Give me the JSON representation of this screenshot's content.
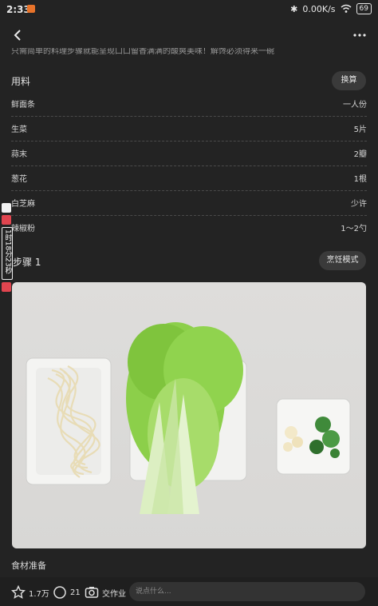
{
  "status": {
    "time": "2:33",
    "net_speed": "0.00K/s",
    "battery": "69"
  },
  "intro_text_fragment": "只需简单的料理步骤就能呈现口口留香满满的酸爽美味！解馋必须得来一碗",
  "ingredients": {
    "title": "用料",
    "swap_label": "换算",
    "items": [
      {
        "name": "鲜面条",
        "qty": "一人份"
      },
      {
        "name": "生菜",
        "qty": "5片"
      },
      {
        "name": "蒜末",
        "qty": "2瓣"
      },
      {
        "name": "葱花",
        "qty": "1根"
      },
      {
        "name": "白芝麻",
        "qty": "少许"
      },
      {
        "name": "辣椒粉",
        "qty": "1～2勺"
      }
    ]
  },
  "floating_timer": {
    "text": "1时18分23秒"
  },
  "step": {
    "title": "步骤 1",
    "cook_mode_label": "烹饪模式",
    "caption": "食材准备"
  },
  "bottom_bar": {
    "likes": "1.7万",
    "comments": "21",
    "homework": "交作业",
    "input_placeholder": "说点什么..."
  },
  "colors": {
    "bg": "#232323",
    "accent_red": "#e0454f"
  },
  "icons": [
    "back-icon",
    "more-icon",
    "star-icon",
    "comment-icon",
    "camera-icon"
  ]
}
